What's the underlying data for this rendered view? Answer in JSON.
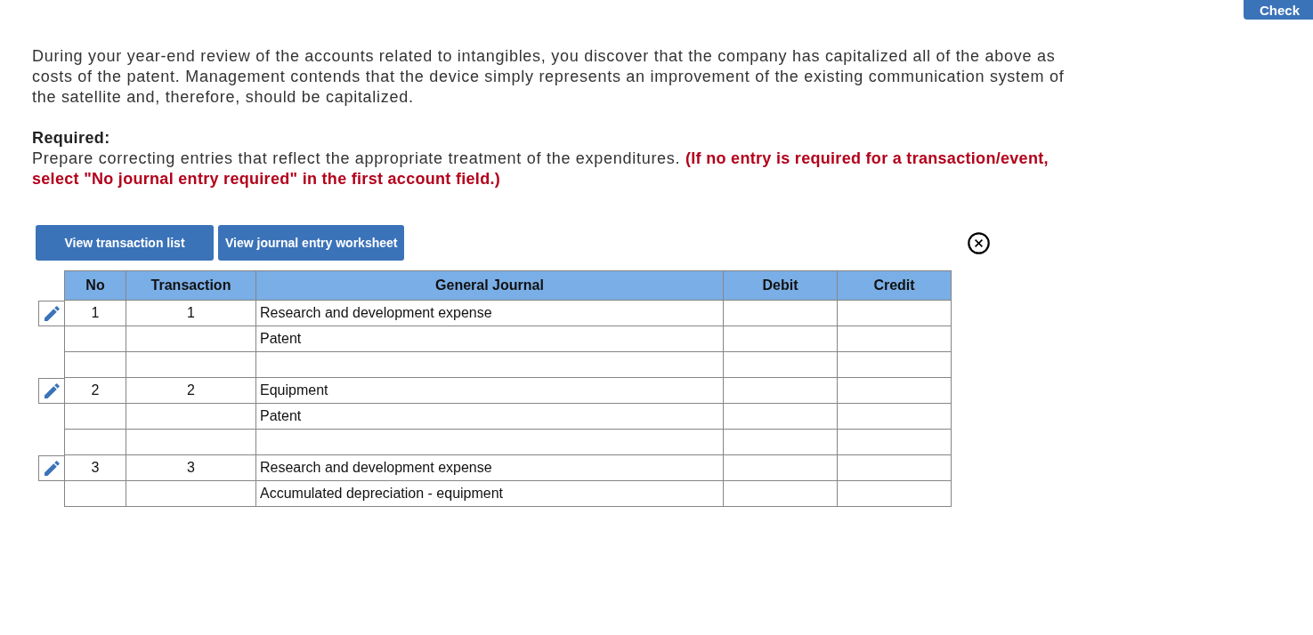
{
  "header_button": {
    "label": "Check"
  },
  "question": {
    "text": "During your year-end review of the accounts related to intangibles, you discover that the company has capitalized all of the above as costs of the patent. Management contends that the device simply represents an improvement of the existing communication system of the satellite and, therefore, should be capitalized.",
    "required_label": "Required:",
    "instructions": "Prepare correcting entries that reflect the appropriate treatment of the expenditures. **(If no entry is required for a transaction/event, select \"No journal entry required\" in the first account field.)**"
  },
  "view_buttons": [
    {
      "label": "View transaction list"
    },
    {
      "label": "View journal entry worksheet"
    }
  ],
  "journal": {
    "columns": [
      "No",
      "Transaction",
      "General Journal",
      "Debit",
      "Credit"
    ],
    "rows": [
      {
        "kind": "entry",
        "no": "1",
        "transaction": "1",
        "account": "Research and development expense"
      },
      {
        "kind": "line",
        "account": "Patent"
      },
      {
        "kind": "blank"
      },
      {
        "kind": "entry",
        "no": "2",
        "transaction": "2",
        "account": "Equipment"
      },
      {
        "kind": "line",
        "account": "Patent"
      },
      {
        "kind": "blank"
      },
      {
        "kind": "entry",
        "no": "3",
        "transaction": "3",
        "account": "Research and development expense"
      },
      {
        "kind": "line",
        "account": "Accumulated depreciation - equipment"
      }
    ]
  }
}
